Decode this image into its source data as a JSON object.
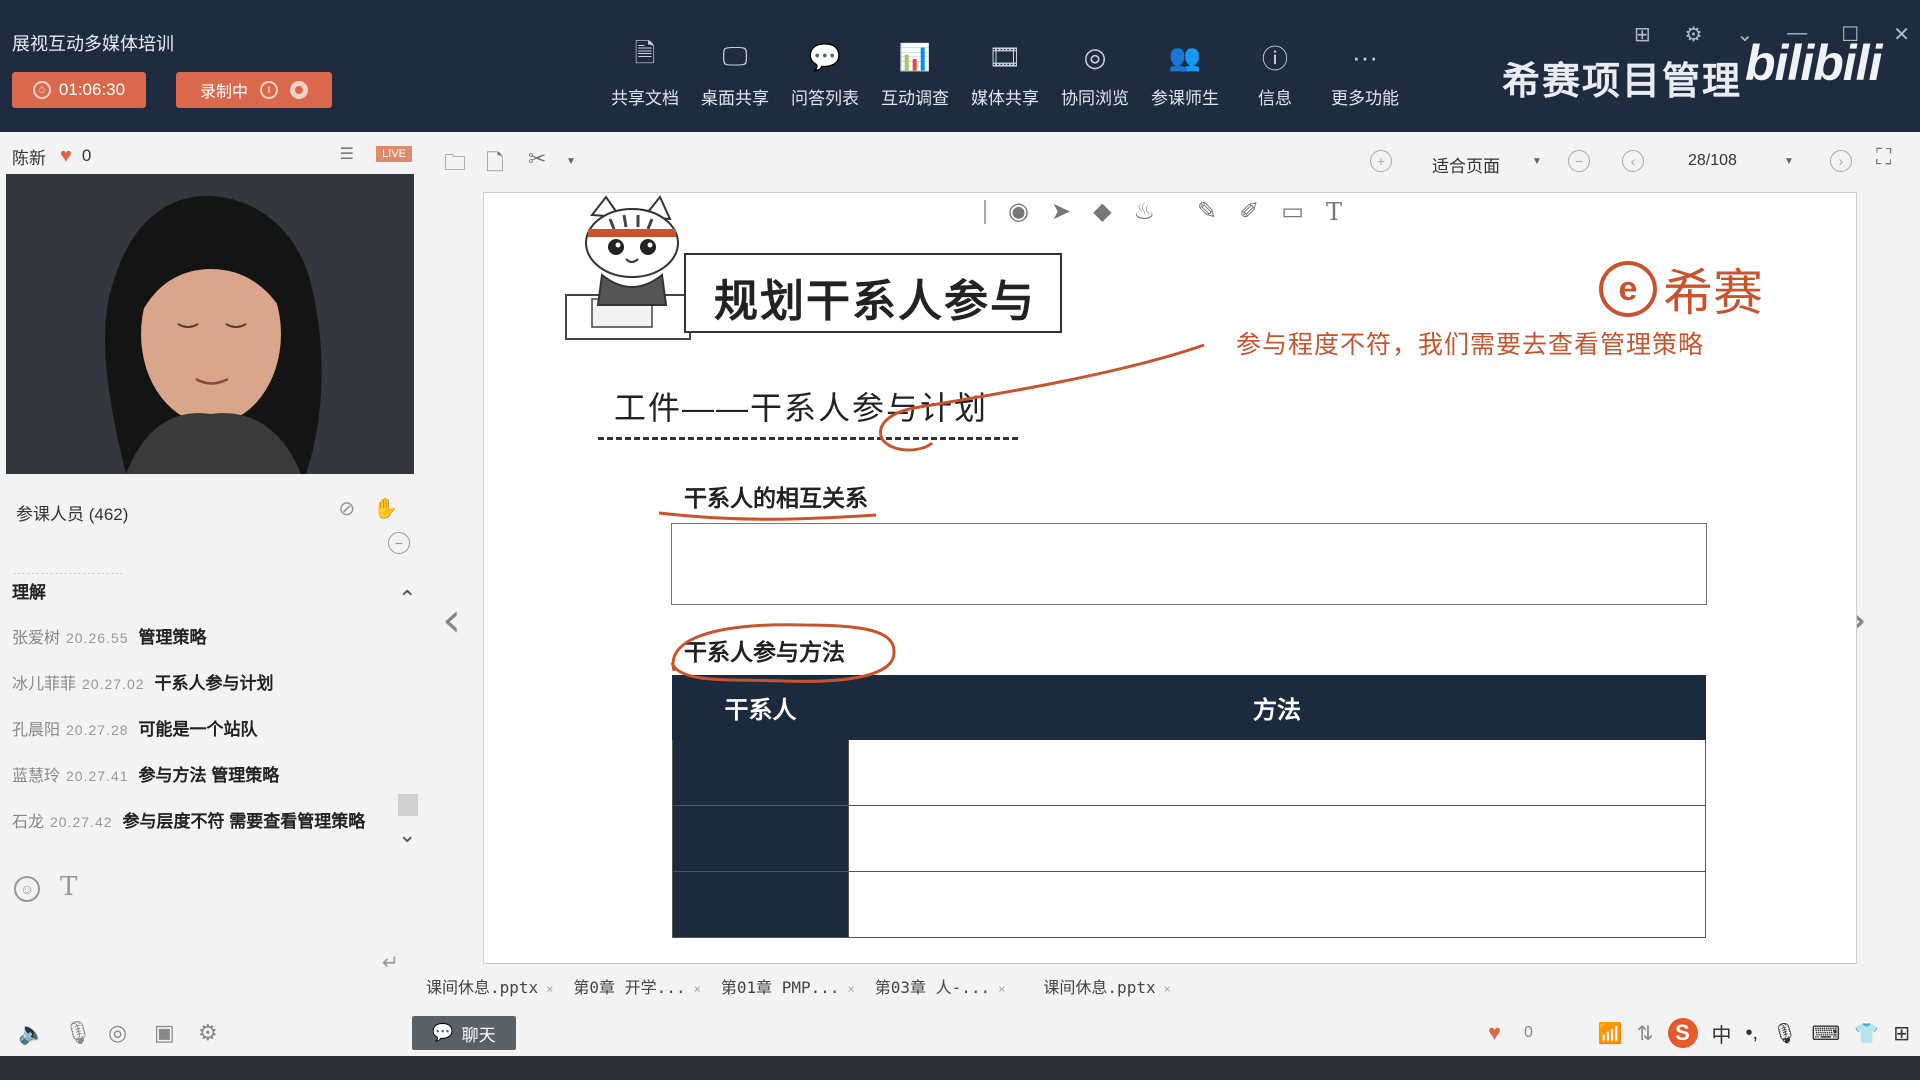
{
  "app": {
    "title": "展视互动多媒体培训",
    "timer": "01:06:30",
    "recording_label": "录制中"
  },
  "toolbar": {
    "items": [
      {
        "label": "共享文档",
        "icon": "share-doc-icon",
        "glyph": "🗎"
      },
      {
        "label": "桌面共享",
        "icon": "desktop-share-icon",
        "glyph": "🖵"
      },
      {
        "label": "问答列表",
        "icon": "qa-list-icon",
        "glyph": "💬"
      },
      {
        "label": "互动调查",
        "icon": "survey-icon",
        "glyph": "📊"
      },
      {
        "label": "媒体共享",
        "icon": "media-share-icon",
        "glyph": "🎞"
      },
      {
        "label": "协同浏览",
        "icon": "co-browse-icon",
        "glyph": "◎"
      },
      {
        "label": "参课师生",
        "icon": "participants-icon",
        "glyph": "👥"
      },
      {
        "label": "信息",
        "icon": "info-icon",
        "glyph": "ⓘ"
      },
      {
        "label": "更多功能",
        "icon": "more-icon",
        "glyph": "···"
      }
    ]
  },
  "brand": {
    "text": "希赛项目管理",
    "platform_logo": "bilibili"
  },
  "presenter": {
    "name": "陈新",
    "likes": "0",
    "live_badge": "LIVE"
  },
  "participants": {
    "label": "参课人员 (462)"
  },
  "chat": {
    "partial_top": "理解",
    "messages": [
      {
        "name": "张爱树",
        "time": "20.26.55",
        "text": "管理策略"
      },
      {
        "name": "冰儿菲菲",
        "time": "20.27.02",
        "text": "干系人参与计划"
      },
      {
        "name": "孔晨阳",
        "time": "20.27.28",
        "text": "可能是一个站队"
      },
      {
        "name": "蓝慧玲",
        "time": "20.27.41",
        "text": "参与方法  管理策略"
      },
      {
        "name": "石龙",
        "time": "20.27.42",
        "text": "参与层度不符  需要查看管理策略"
      }
    ]
  },
  "doc_toolbar": {
    "fit_label": "适合页面",
    "page_counter": "28/108"
  },
  "slide": {
    "title": "规划干系人参与",
    "brand_name": "希赛",
    "annotation": "参与程度不符，我们需要去查看管理策略",
    "artifact_heading": "工件——干系人参与计划",
    "relationship_heading": "干系人的相互关系",
    "method_heading": "干系人参与方法",
    "table_headers": [
      "干系人",
      "方法"
    ],
    "table_rows": 3
  },
  "file_tabs": [
    "课间休息.pptx",
    "第0章 开学...",
    "第01章 PMP...",
    "第03章 人-...",
    "课间休息.pptx"
  ],
  "bottom": {
    "chat_button": "聊天",
    "heart_count": "0",
    "ime_lang": "中"
  },
  "colors": {
    "topbar_bg": "#1f2c40",
    "accent_orange": "#d9694a",
    "annotation_red": "#c8542e",
    "table_header_bg": "#1c2a3e"
  }
}
